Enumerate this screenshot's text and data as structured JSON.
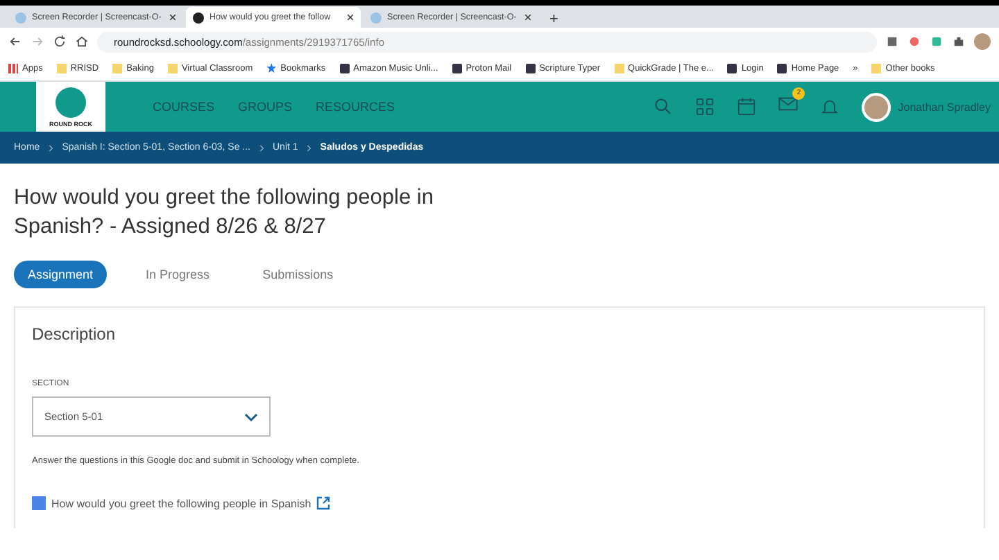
{
  "browser": {
    "tabs": [
      {
        "title": "Screen Recorder | Screencast-O-",
        "selected": false
      },
      {
        "title": "How would you greet the follow",
        "selected": true
      },
      {
        "title": "Screen Recorder | Screencast-O-",
        "selected": false
      }
    ],
    "new_tab": "+",
    "address": {
      "host": "roundrocksd.schoology.com",
      "path": "/assignments/2919371765/info"
    },
    "bookmarks": [
      {
        "label": "Apps",
        "kind": "apps"
      },
      {
        "label": "RRISD",
        "kind": "folder"
      },
      {
        "label": "Baking",
        "kind": "folder"
      },
      {
        "label": "Virtual Classroom",
        "kind": "folder"
      },
      {
        "label": "Bookmarks",
        "kind": "star"
      },
      {
        "label": "Amazon Music Unli...",
        "kind": "site"
      },
      {
        "label": "Proton Mail",
        "kind": "site"
      },
      {
        "label": "Scripture Typer",
        "kind": "site"
      },
      {
        "label": "QuickGrade | The e...",
        "kind": "folder"
      },
      {
        "label": "Login",
        "kind": "site"
      },
      {
        "label": "Home Page",
        "kind": "site"
      }
    ],
    "more": "»",
    "other": "Other books"
  },
  "nav": {
    "logo": "ROUND ROCK",
    "links": [
      "COURSES",
      "GROUPS",
      "RESOURCES"
    ],
    "mail_badge": "2",
    "user": "Jonathan Spradley"
  },
  "breadcrumb": [
    {
      "label": "Home",
      "current": false
    },
    {
      "label": "Spanish I: Section 5-01, Section 6-03, Se ...",
      "current": false
    },
    {
      "label": "Unit 1",
      "current": false
    },
    {
      "label": "Saludos y Despedidas",
      "current": true
    }
  ],
  "title": "How would you greet the following people in Spanish? - Assigned 8/26 & 8/27",
  "tabs": [
    {
      "label": "Assignment",
      "selected": true
    },
    {
      "label": "In Progress",
      "selected": false
    },
    {
      "label": "Submissions",
      "selected": false
    }
  ],
  "description": {
    "heading": "Description",
    "section_label": "SECTION",
    "section_value": "Section 5-01",
    "instructions": "Answer the questions in this Google doc and submit in Schoology when complete.",
    "link": "How would you greet the following people in Spanish"
  }
}
